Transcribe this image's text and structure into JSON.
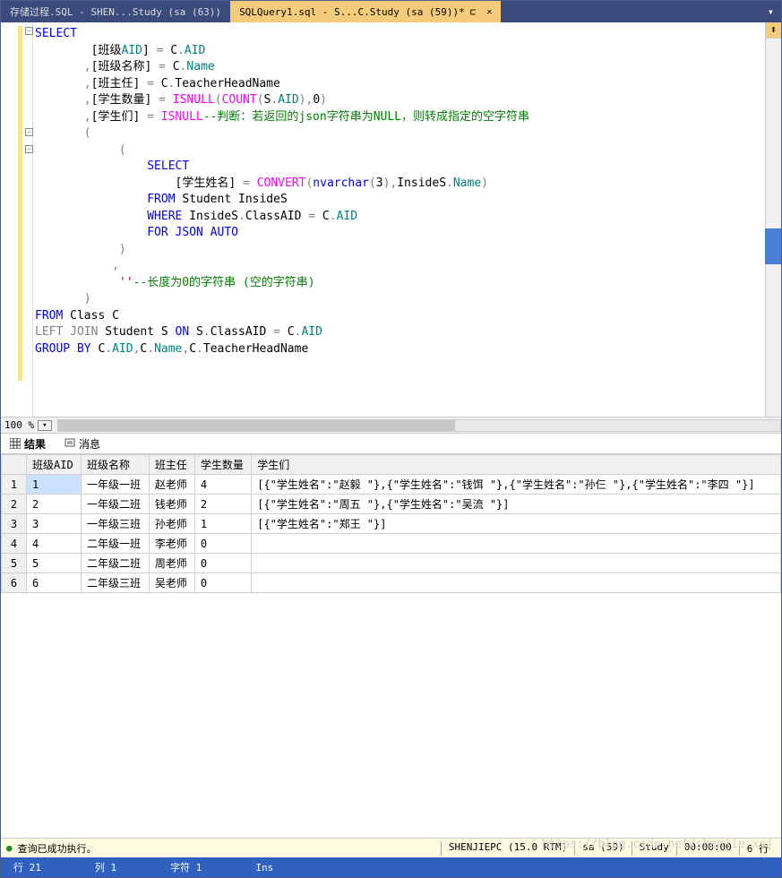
{
  "tabs": {
    "inactive_label": "存储过程.SQL - SHEN...Study (sa (63))",
    "active_label": "SQLQuery1.sql - S...C.Study (sa (59))*"
  },
  "code": {
    "l1_select": "SELECT",
    "l2_a": "        [班级",
    "l2_b": "AID",
    "l2_c": "] ",
    "l2_d": "=",
    "l2_e": " C",
    "l2_f": ".",
    "l2_g": "AID",
    "l3_a": "       ",
    "l3_b": ",",
    "l3_c": "[班级名称] ",
    "l3_d": "=",
    "l3_e": " C",
    "l3_f": ".",
    "l3_g": "Name",
    "l4_a": "       ",
    "l4_b": ",",
    "l4_c": "[班主任] ",
    "l4_d": "=",
    "l4_e": " C",
    "l4_f": ".",
    "l4_g": "TeacherHeadName",
    "l5_a": "       ",
    "l5_b": ",",
    "l5_c": "[学生数量] ",
    "l5_d": "=",
    "l5_e": " ",
    "l5_f": "ISNULL",
    "l5_g": "(",
    "l5_h": "COUNT",
    "l5_i": "(",
    "l5_j": "S",
    "l5_k": ".",
    "l5_l": "AID",
    "l5_m": "),",
    "l5_n": "0",
    "l5_o": ")",
    "l6_a": "       ",
    "l6_b": ",",
    "l6_c": "[学生们] ",
    "l6_d": "=",
    "l6_e": " ",
    "l6_f": "ISNULL",
    "l6_g": "--判断：若返回的json字符串为NULL，则转成指定的空字符串",
    "l7": "       (",
    "l8": "            (",
    "l9_a": "                ",
    "l9_b": "SELECT",
    "l10_a": "                    [学生姓名] ",
    "l10_b": "=",
    "l10_c": " ",
    "l10_d": "CONVERT",
    "l10_e": "(",
    "l10_f": "nvarchar",
    "l10_g": "(",
    "l10_h": "3",
    "l10_i": "),",
    "l10_j": "InsideS",
    "l10_k": ".",
    "l10_l": "Name",
    "l10_m": ")",
    "l11_a": "                ",
    "l11_b": "FROM",
    "l11_c": " Student InsideS",
    "l12_a": "                ",
    "l12_b": "WHERE",
    "l12_c": " InsideS",
    "l12_d": ".",
    "l12_e": "ClassAID ",
    "l12_f": "=",
    "l12_g": " C",
    "l12_h": ".",
    "l12_i": "AID",
    "l13_a": "                ",
    "l13_b": "FOR",
    "l13_c": " ",
    "l13_d": "JSON AUTO",
    "l14": "            )",
    "l15": "           ,",
    "l16_a": "            ",
    "l16_b": "''",
    "l16_c": "--长度为0的字符串 (空的字符串)",
    "l17": "       )",
    "l18_a": "FROM",
    "l18_b": " Class C",
    "l19_a": "LEFT",
    "l19_b": " ",
    "l19_c": "JOIN",
    "l19_d": " Student S ",
    "l19_e": "ON",
    "l19_f": " S",
    "l19_g": ".",
    "l19_h": "ClassAID ",
    "l19_i": "=",
    "l19_j": " C",
    "l19_k": ".",
    "l19_l": "AID",
    "l20_a": "GROUP",
    "l20_b": " ",
    "l20_c": "BY",
    "l20_d": " C",
    "l20_e": ".",
    "l20_f": "AID",
    "l20_g": ",",
    "l20_h": "C",
    "l20_i": ".",
    "l20_j": "Name",
    "l20_k": ",",
    "l20_l": "C",
    "l20_m": ".",
    "l20_n": "TeacherHeadName"
  },
  "zoom": {
    "pct": "100 %"
  },
  "result_tabs": {
    "results": "结果",
    "messages": "消息"
  },
  "grid": {
    "headers": [
      "班级AID",
      "班级名称",
      "班主任",
      "学生数量",
      "学生们"
    ],
    "rows": [
      {
        "n": "1",
        "cells": [
          "1",
          "一年级一班",
          "赵老师",
          "4",
          "[{\"学生姓名\":\"赵毅 \"},{\"学生姓名\":\"钱饵 \"},{\"学生姓名\":\"孙仨 \"},{\"学生姓名\":\"李四 \"}]"
        ]
      },
      {
        "n": "2",
        "cells": [
          "2",
          "一年级二班",
          "钱老师",
          "2",
          "[{\"学生姓名\":\"周五 \"},{\"学生姓名\":\"吴流 \"}]"
        ]
      },
      {
        "n": "3",
        "cells": [
          "3",
          "一年级三班",
          "孙老师",
          "1",
          "[{\"学生姓名\":\"郑王 \"}]"
        ]
      },
      {
        "n": "4",
        "cells": [
          "4",
          "二年级一班",
          "李老师",
          "0",
          ""
        ]
      },
      {
        "n": "5",
        "cells": [
          "5",
          "二年级二班",
          "周老师",
          "0",
          ""
        ]
      },
      {
        "n": "6",
        "cells": [
          "6",
          "二年级三班",
          "吴老师",
          "0",
          ""
        ]
      }
    ]
  },
  "status_success": {
    "msg": "查询已成功执行。",
    "server": "SHENJIEPC (15.0 RTM)",
    "user": "sa (59)",
    "db": "Study",
    "time": "00:00:00",
    "rows": "6 行"
  },
  "footer": {
    "line": "行 21",
    "col": "列 1",
    "char": "字符 1",
    "ins": "Ins"
  },
  "watermark": "https://blog.csdn.net/shenjie_xsj"
}
